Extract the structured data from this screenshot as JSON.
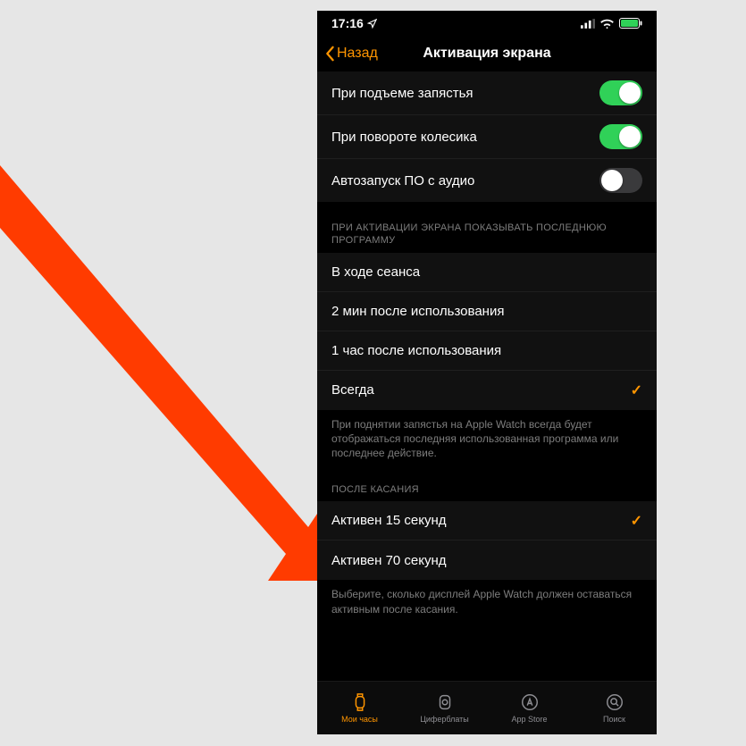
{
  "status": {
    "time": "17:16"
  },
  "nav": {
    "back": "Назад",
    "title": "Активация экрана"
  },
  "toggles": [
    {
      "label": "При подъеме запястья",
      "on": true
    },
    {
      "label": "При повороте колесика",
      "on": true
    },
    {
      "label": "Автозапуск ПО с аудио",
      "on": false
    }
  ],
  "section1": {
    "header": "ПРИ АКТИВАЦИИ ЭКРАНА ПОКАЗЫВАТЬ ПОСЛЕДНЮЮ ПРОГРАММУ",
    "options": [
      {
        "label": "В ходе сеанса",
        "selected": false
      },
      {
        "label": "2 мин после использования",
        "selected": false
      },
      {
        "label": "1 час после использования",
        "selected": false
      },
      {
        "label": "Всегда",
        "selected": true
      }
    ],
    "footer": "При поднятии запястья на Apple Watch всегда будет отображаться последняя использованная программа или последнее действие."
  },
  "section2": {
    "header": "ПОСЛЕ КАСАНИЯ",
    "options": [
      {
        "label": "Активен 15 секунд",
        "selected": true
      },
      {
        "label": "Активен 70 секунд",
        "selected": false
      }
    ],
    "footer": "Выберите, сколько дисплей Apple Watch должен оставаться активным после касания."
  },
  "tabs": [
    {
      "label": "Мои часы",
      "active": true
    },
    {
      "label": "Циферблаты",
      "active": false
    },
    {
      "label": "App Store",
      "active": false
    },
    {
      "label": "Поиск",
      "active": false
    }
  ],
  "colors": {
    "accent": "#ff9500",
    "toggleOn": "#30d158"
  }
}
